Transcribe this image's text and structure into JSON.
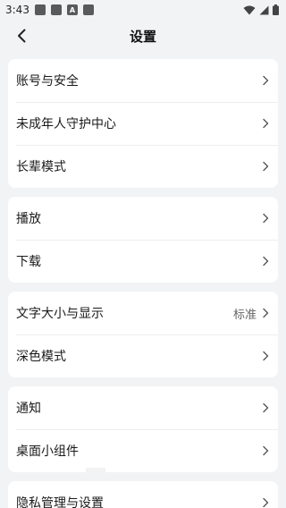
{
  "status_bar": {
    "time": "3:43",
    "icons": [
      "notification-icon",
      "notification-icon",
      "a-icon",
      "notification-icon"
    ],
    "right_icons": [
      "wifi-icon",
      "signal-icon",
      "battery-icon"
    ]
  },
  "header": {
    "title": "设置",
    "back_icon": "chevron-left-icon"
  },
  "groups": [
    {
      "items": [
        {
          "label": "账号与安全"
        },
        {
          "label": "未成年人守护中心"
        },
        {
          "label": "长辈模式"
        }
      ]
    },
    {
      "items": [
        {
          "label": "播放"
        },
        {
          "label": "下载"
        }
      ]
    },
    {
      "items": [
        {
          "label": "文字大小与显示",
          "value": "标准"
        },
        {
          "label": "深色模式"
        }
      ]
    },
    {
      "items": [
        {
          "label": "通知"
        },
        {
          "label": "桌面小组件"
        }
      ]
    },
    {
      "items": [
        {
          "label": "隐私管理与设置"
        }
      ]
    }
  ],
  "colors": {
    "background": "#f2f3f5",
    "card": "#ffffff",
    "text": "#1a1a1a",
    "secondary_text": "#666666",
    "chevron": "#555555"
  }
}
